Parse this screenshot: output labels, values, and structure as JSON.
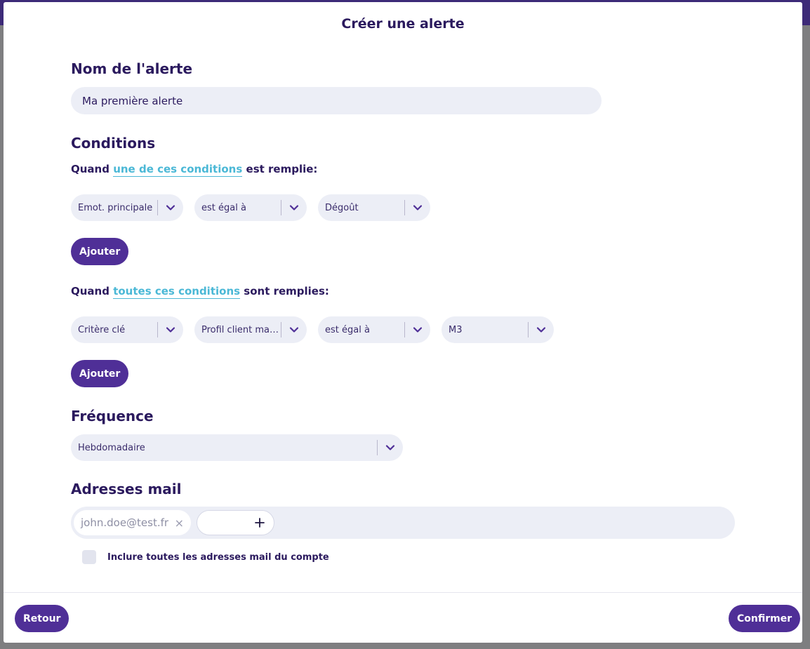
{
  "modal": {
    "title": "Créer une alerte"
  },
  "alert_name": {
    "title": "Nom de l'alerte",
    "value": "Ma première alerte"
  },
  "conditions": {
    "title": "Conditions",
    "group_any": {
      "prefix": "Quand",
      "link": "une de ces conditions",
      "suffix": "est remplie:",
      "selects": [
        "Emot. principale",
        "est égal à",
        "Dégoût"
      ],
      "add_label": "Ajouter"
    },
    "group_all": {
      "prefix": "Quand",
      "link": "toutes ces conditions",
      "suffix": "sont remplies:",
      "selects": [
        "Critère clé",
        "Profil client maga...",
        "est égal à",
        "M3"
      ],
      "add_label": "Ajouter"
    }
  },
  "frequency": {
    "title": "Fréquence",
    "value": "Hebdomadaire"
  },
  "emails": {
    "title": "Adresses mail",
    "chips": [
      "john.doe@test.fr"
    ],
    "include_all_label": "Inclure toutes les adresses mail du compte",
    "include_all_checked": false
  },
  "footer": {
    "back_label": "Retour",
    "confirm_label": "Confirmer"
  },
  "colors": {
    "primary": "#4f2f97",
    "link": "#4bb8d6",
    "field_bg": "#eceef6",
    "text": "#2b1a5e"
  },
  "icons": {
    "select": "chevron-down-icon",
    "remove_chip": "close-icon",
    "add_chip": "plus-icon"
  }
}
